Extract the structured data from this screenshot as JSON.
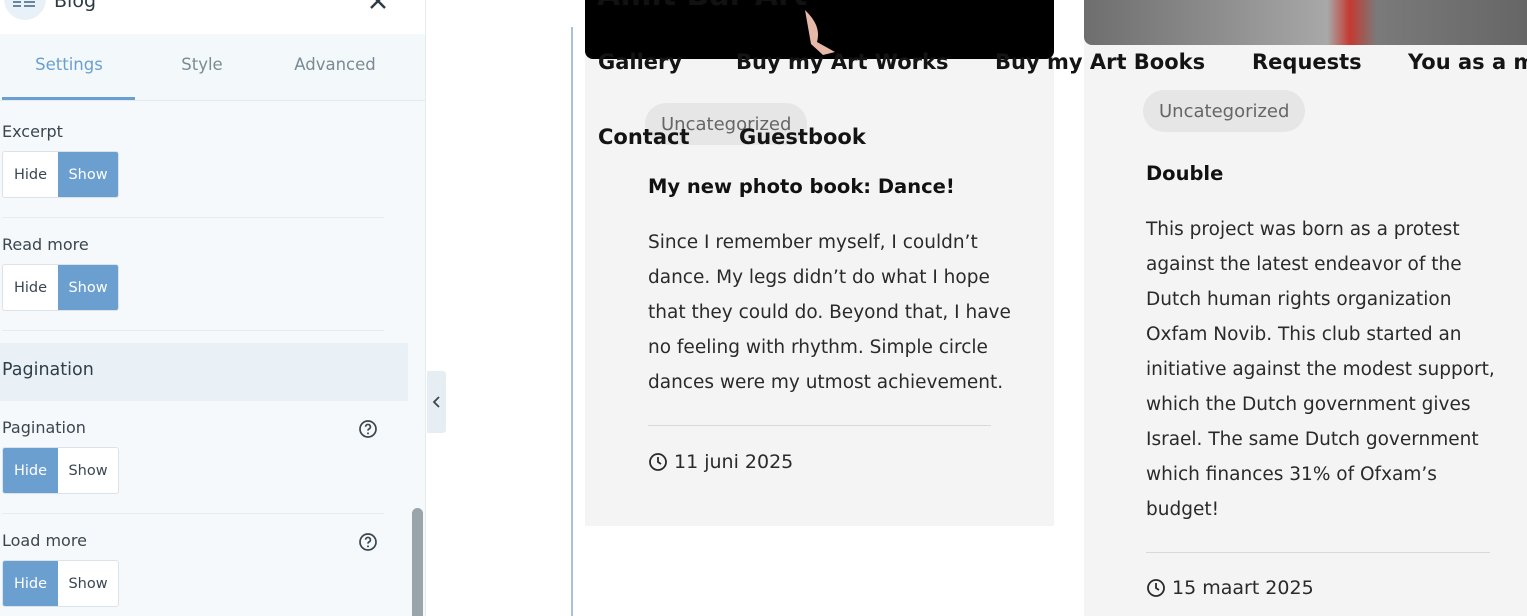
{
  "panel": {
    "title": "Blog",
    "tabs": [
      {
        "label": "Settings"
      },
      {
        "label": "Style"
      },
      {
        "label": "Advanced"
      }
    ],
    "excerpt": {
      "label": "Excerpt",
      "hide": "Hide",
      "show": "Show",
      "selected": "Show"
    },
    "read_more": {
      "label": "Read more",
      "hide": "Hide",
      "show": "Show",
      "selected": "Show"
    },
    "section": "Pagination",
    "pagination": {
      "label": "Pagination",
      "hide": "Hide",
      "show": "Show",
      "selected": "Hide"
    },
    "load_more": {
      "label": "Load more",
      "hide": "Hide",
      "show": "Show",
      "selected": "Hide"
    },
    "accent": "#6a9fd0"
  },
  "site": {
    "title": "Amit Bar Art",
    "nav": [
      "Gallery",
      "Buy my Art Works",
      "Buy my Art Books",
      "Requests",
      "You as a m",
      "Contact",
      "Guestbook"
    ]
  },
  "posts": [
    {
      "category": "Uncategorized",
      "title": "My new photo book: Dance!",
      "excerpt": [
        "Since I remember myself, I couldn’t",
        "dance. My legs didn’t do what I hope",
        "that they could do. Beyond that, I have",
        "no feeling with rhythm. Simple circle",
        "dances were my utmost achievement."
      ],
      "date": "11 juni 2025"
    },
    {
      "category": "Uncategorized",
      "title": "Double",
      "excerpt": [
        "This project was born as a protest",
        "against the latest endeavor of the",
        "Dutch human rights organization",
        "Oxfam Novib. This club started an",
        "initiative against the modest support,",
        "which the Dutch government gives",
        "Israel. The same Dutch government",
        "which finances 31% of Ofxam’s",
        "budget!"
      ],
      "date": "15 maart 2025"
    }
  ]
}
